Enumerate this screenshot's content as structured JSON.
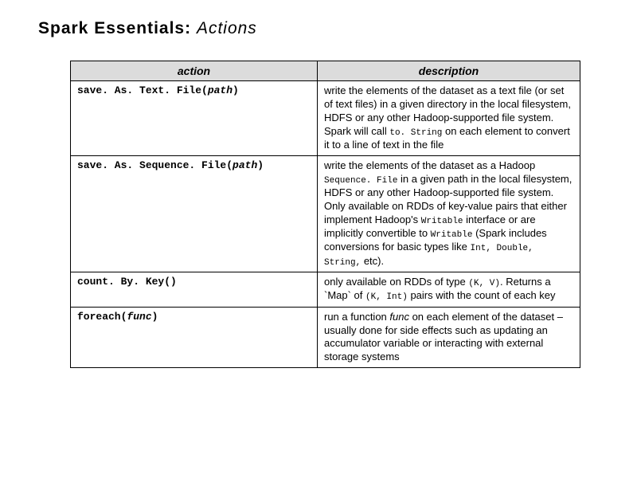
{
  "title": {
    "main": "Spark Essentials:",
    "sub": "Actions"
  },
  "headers": {
    "action": "action",
    "description": "description"
  },
  "rows": {
    "r0": {
      "fn": "save. As. Text. File(",
      "param": "path",
      "close": ")",
      "desc_pre": "write the elements of the dataset as a text file (or set of text files) in a given directory in the local filesystem, HDFS or any other Hadoop-supported file system. Spark will call ",
      "code0": "to. String",
      "desc_post": " on each element to convert it to a line of text in the file"
    },
    "r1": {
      "fn": "save. As. Sequence. File(",
      "param": "path",
      "close": ")",
      "t0": "write the elements of the dataset as a Hadoop ",
      "c0": "Sequence. File",
      "t1": " in a given path in the local filesystem, HDFS or any other Hadoop-supported file system. Only available on RDDs of key-value pairs that either implement Hadoop's ",
      "c1": "Writable",
      "t2": " interface or are implicitly convertible to ",
      "c2": "Writable",
      "t3": " (Spark includes conversions for basic types like ",
      "c3": "Int, Double, String,",
      "t4": " etc)."
    },
    "r2": {
      "fn": "count. By. Key()",
      "t0": "only available on RDDs of type ",
      "c0": "(K, V)",
      "t1": ". Returns a `Map` of ",
      "c1": "(K, Int)",
      "t2": " pairs with the count of each key"
    },
    "r3": {
      "fn": "foreach(",
      "param": "func",
      "close": ")",
      "t0": "run a function ",
      "f0": "func",
      "t1": " on each element of the dataset – usually done for side effects such as updating an accumulator variable or interacting with external storage systems"
    }
  }
}
